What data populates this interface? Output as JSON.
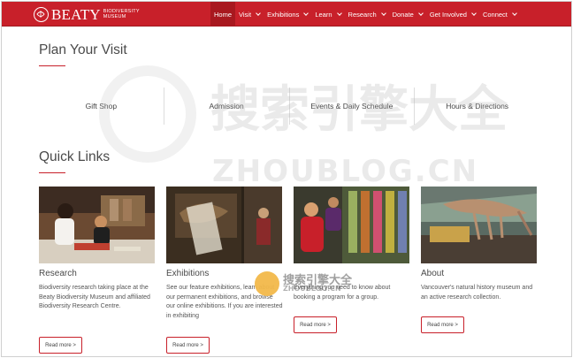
{
  "brand": {
    "name": "BEATY",
    "sub_line1": "BIODIVERSITY",
    "sub_line2": "MUSEUM"
  },
  "nav": [
    {
      "label": "Home",
      "active": true,
      "dropdown": false
    },
    {
      "label": "Visit",
      "active": false,
      "dropdown": true
    },
    {
      "label": "Exhibitions",
      "active": false,
      "dropdown": true
    },
    {
      "label": "Learn",
      "active": false,
      "dropdown": true
    },
    {
      "label": "Research",
      "active": false,
      "dropdown": true
    },
    {
      "label": "Donate",
      "active": false,
      "dropdown": true
    },
    {
      "label": "Get Involved",
      "active": false,
      "dropdown": true
    },
    {
      "label": "Connect",
      "active": false,
      "dropdown": true
    }
  ],
  "plan": {
    "title": "Plan Your Visit",
    "items": [
      "Gift Shop",
      "Admission",
      "Events & Daily Schedule",
      "Hours & Directions"
    ]
  },
  "quick_links": {
    "title": "Quick Links",
    "cards": [
      {
        "title": "Research",
        "desc": "Biodiversity research taking place at the Beaty Biodiversity Museum and affiliated Biodiversity Research Centre.",
        "button": "Read more >"
      },
      {
        "title": "Exhibitions",
        "desc": "See our feature exhibitions, learn about our permanent exhibitions, and browse our online exhibitions. If you are interested in exhibiting",
        "button": "Read more >"
      },
      {
        "title": "",
        "desc": "Everything you need to know about booking a program for a group.",
        "button": "Read more >"
      },
      {
        "title": "About",
        "desc": "Vancouver's natural history museum and an active research collection.",
        "button": "Read more >"
      }
    ]
  },
  "watermark": {
    "big": "搜索引擎大全",
    "url": "ZHOUBLOG.CN",
    "small": "搜索引擎大全",
    "small_url": "ZHOUBLOG.CN"
  },
  "colors": {
    "brand_red": "#c8202a"
  }
}
